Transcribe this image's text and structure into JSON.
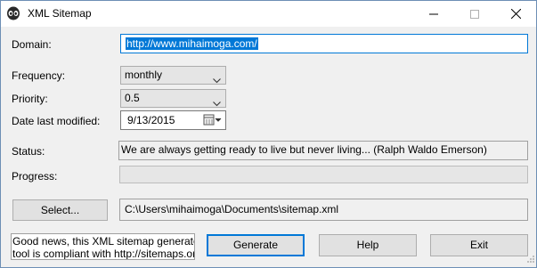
{
  "window": {
    "title": "XML Sitemap",
    "icon": "alien-head-icon"
  },
  "form": {
    "domain_label": "Domain:",
    "domain_value": "http://www.mihaimoga.com/",
    "frequency_label": "Frequency:",
    "frequency_value": "monthly",
    "priority_label": "Priority:",
    "priority_value": "0.5",
    "date_label": "Date last modified:",
    "date_value": "9/13/2015",
    "status_label": "Status:",
    "status_value": "We are always getting ready to live but never living... (Ralph Waldo Emerson)",
    "progress_label": "Progress:",
    "progress_value": 0
  },
  "file": {
    "select_label": "Select...",
    "path": "C:\\Users\\mihaimoga\\Documents\\sitemap.xml"
  },
  "footer": {
    "info_line1": "Good news, this XML sitemap generator",
    "info_line2": "tool is compliant with http://sitemaps.org/.",
    "generate_label": "Generate",
    "help_label": "Help",
    "exit_label": "Exit"
  },
  "colors": {
    "selection": "#0078d7",
    "focus_border": "#0078d7"
  }
}
